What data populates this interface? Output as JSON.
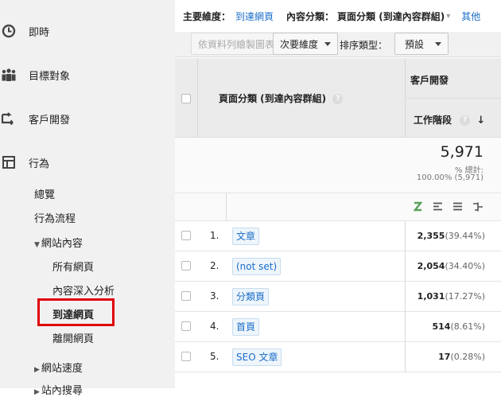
{
  "sidebar": {
    "realtime": "即時",
    "audience": "目標對象",
    "acquisition": "客戶開發",
    "behavior": "行為",
    "overview": "總覽",
    "behavior_flow": "行為流程",
    "site_content": "網站內容",
    "all_pages": "所有網頁",
    "content_drilldown": "內容深入分析",
    "landing_pages": "到達網頁",
    "exit_pages": "離開網頁",
    "site_speed": "網站速度",
    "cut_off_item": "站內搜尋"
  },
  "dimension_bar": {
    "primary_label": "主要維度：",
    "primary_value": "到達網頁",
    "content_label": "內容分類：",
    "content_value": "頁面分類 (到達內容群組)",
    "other": "其他"
  },
  "toolbar": {
    "plot_rows": "依資料列繪製圖表",
    "secondary_dim": "次要維度",
    "sort_type_label": "排序類型：",
    "sort_default": "預設"
  },
  "table": {
    "dim_header": "頁面分類 (到達內容群組)",
    "group_header": "客戶開發",
    "metric_header": "工作階段",
    "total_value": "5,971",
    "total_pct_label": "% 總計:",
    "total_pct_value": "100.00% (5,971)",
    "rows": [
      {
        "num": "1.",
        "label": "文章",
        "value": "2,355",
        "pct": "(39.44%)"
      },
      {
        "num": "2.",
        "label": "(not set)",
        "value": "2,054",
        "pct": "(34.40%)"
      },
      {
        "num": "3.",
        "label": "分類頁",
        "value": "1,031",
        "pct": "(17.27%)"
      },
      {
        "num": "4.",
        "label": "首頁",
        "value": "514",
        "pct": "(8.61%)"
      },
      {
        "num": "5.",
        "label": "SEO 文章",
        "value": "17",
        "pct": "(0.28%)"
      }
    ]
  }
}
